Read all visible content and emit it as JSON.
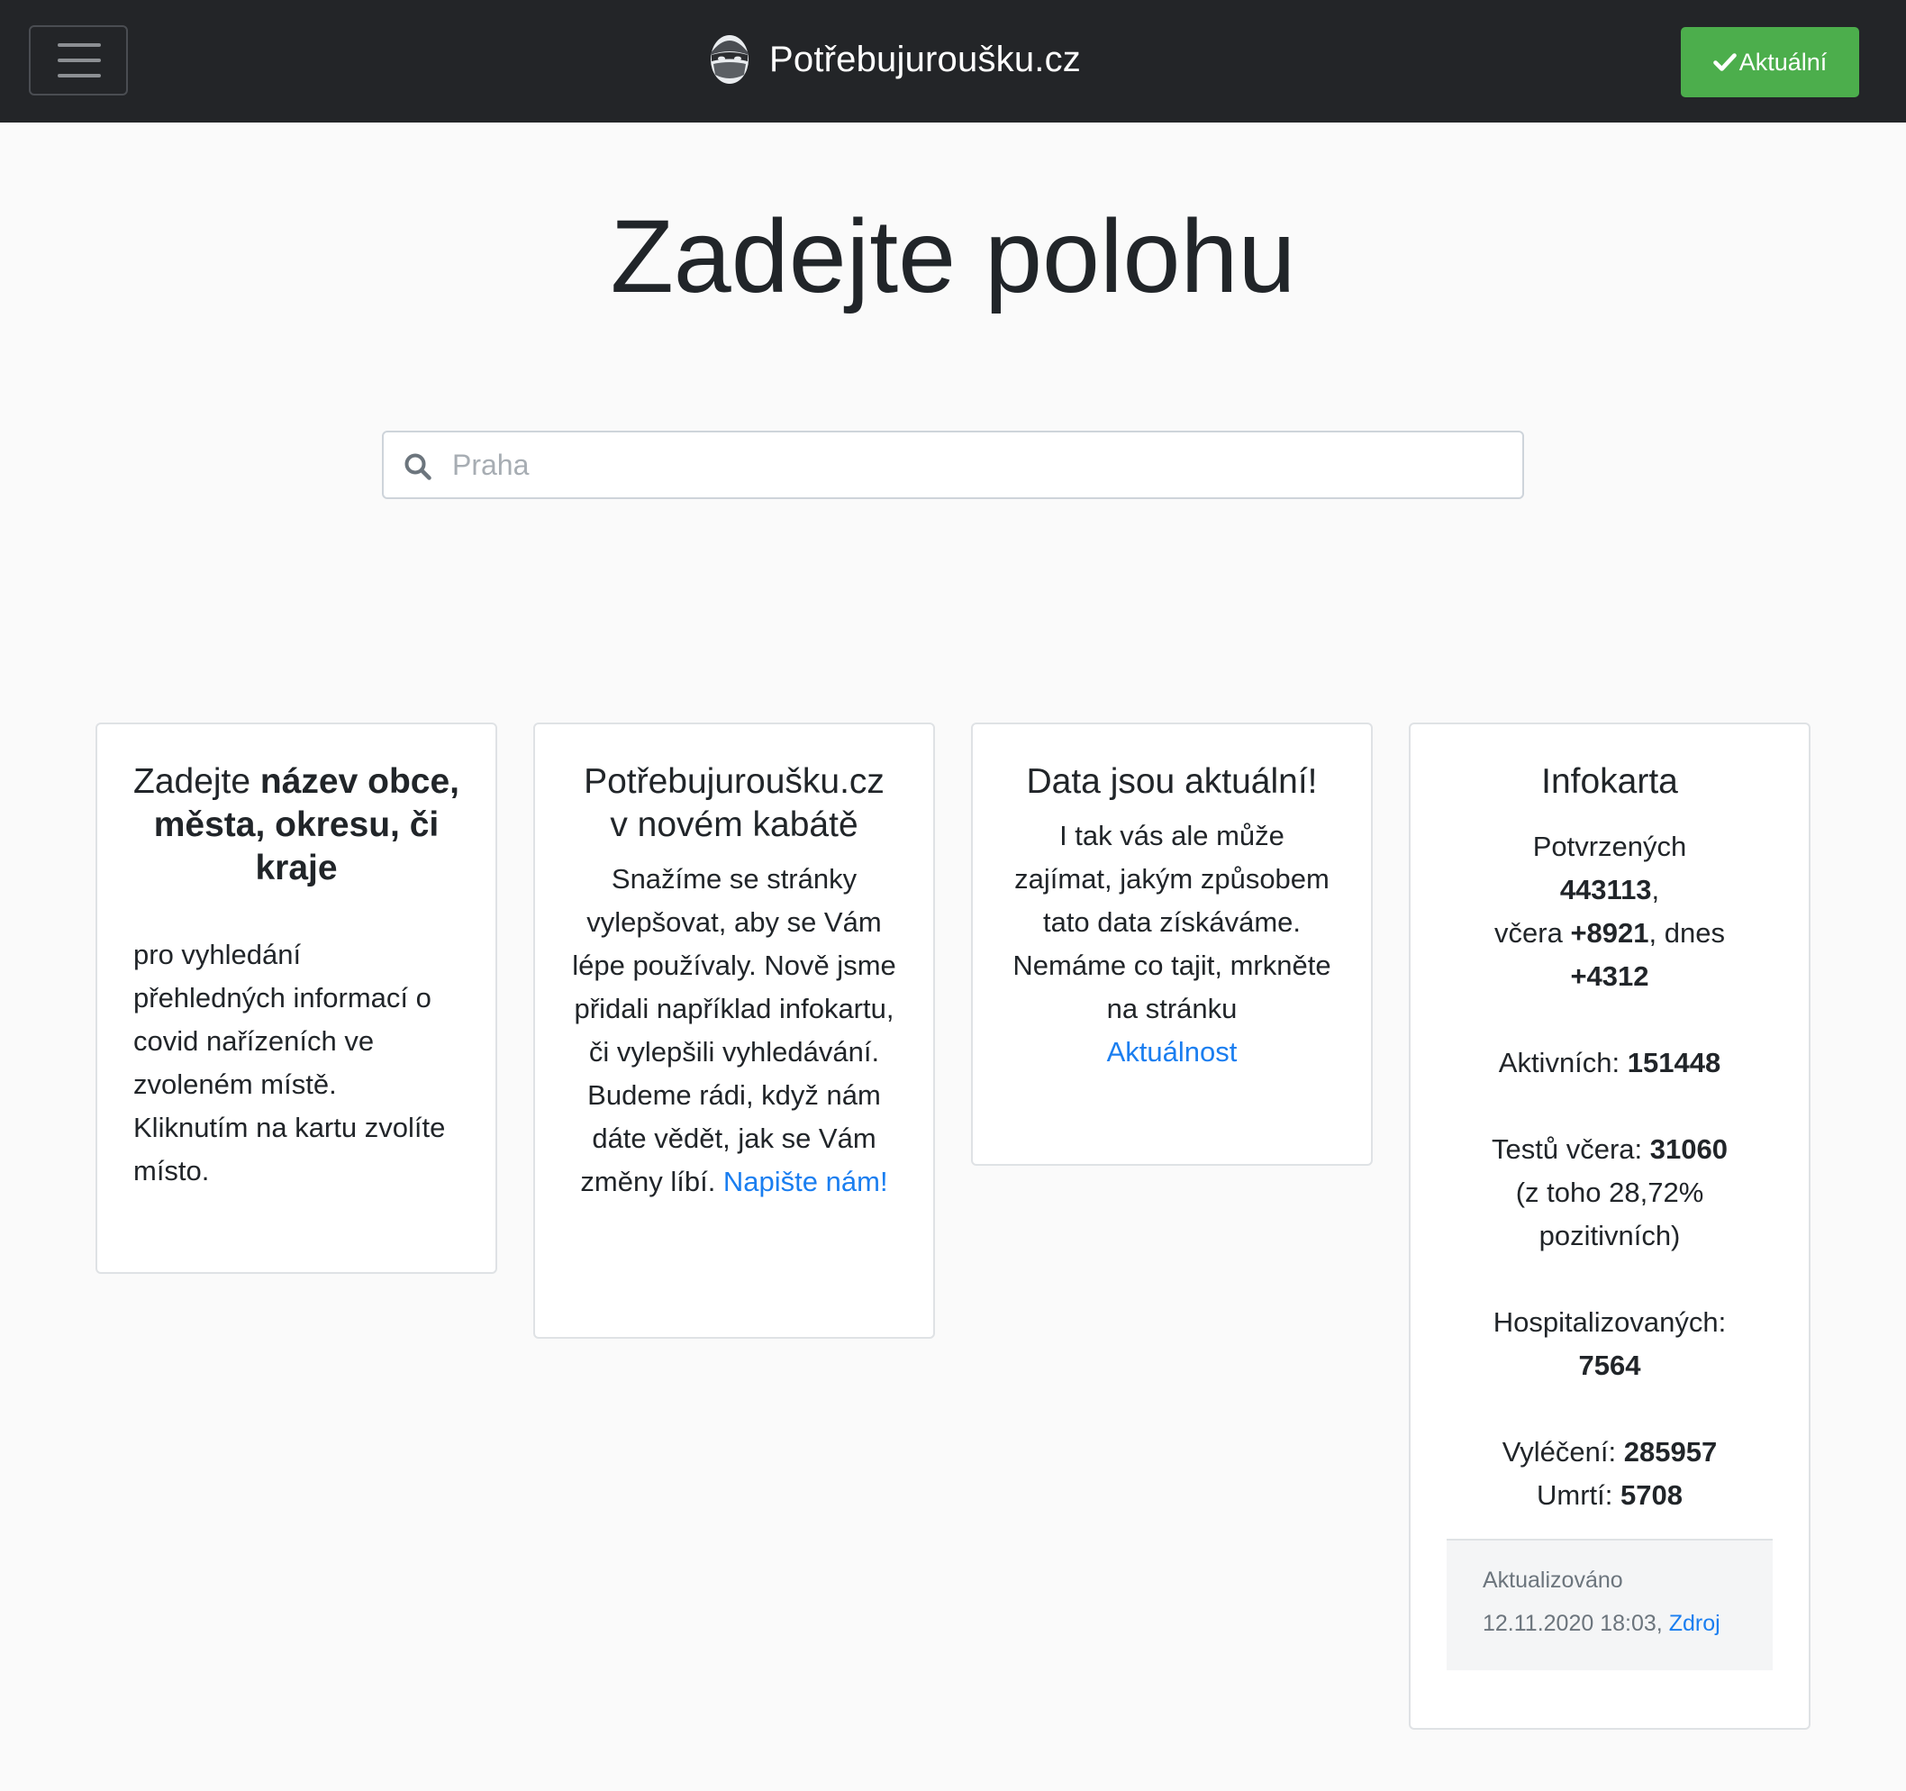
{
  "navbar": {
    "brand_name": "Potřebujuroušku.cz",
    "status_button_label": "Aktuální",
    "colors": {
      "background": "#232528",
      "status_button": "#4cae4c"
    }
  },
  "page": {
    "title": "Zadejte polohu"
  },
  "search": {
    "placeholder": "Praha",
    "value": ""
  },
  "cards": {
    "instructions": {
      "title_prefix": "Zadejte ",
      "title_bold": "název obce, města, okresu, či kraje",
      "text": "pro vyhledání přehledných informací o covid nařízeních ve zvoleném místě. Kliknutím na kartu zvolíte místo."
    },
    "news": {
      "title": "Potřebujuroušku.cz v novém kabátě",
      "text": "Snažíme se stránky vylepšovat, aby se Vám lépe používaly. Nově jsme přidali například infokartu, či vylepšili vyhledávání. Budeme rádi, když nám dáte vědět, jak se Vám změny líbí. ",
      "link_label": "Napište nám!"
    },
    "data": {
      "title": "Data jsou aktuální!",
      "text": "I tak vás ale může zajímat, jakým způsobem tato data získáváme. Nemáme co tajit, mrkněte na stránku",
      "link_label": "Aktuálnost"
    },
    "infocard": {
      "title": "Infokarta",
      "confirmed_label": "Potvrzených",
      "confirmed_value": "443113",
      "yesterday_label": "včera",
      "yesterday_value": "+8921",
      "today_label": "dnes",
      "today_value": "+4312",
      "active_label": "Aktivních:",
      "active_value": "151448",
      "tests_label": "Testů včera:",
      "tests_value": "31060",
      "tests_note": "(z toho 28,72% pozitivních)",
      "hospitalized_label": "Hospitalizovaných:",
      "hospitalized_value": "7564",
      "recovered_label": "Vyléčení:",
      "recovered_value": "285957",
      "deaths_label": "Umrtí:",
      "deaths_value": "5708",
      "footer_updated_label": "Aktualizováno",
      "footer_updated_value": "12.11.2020 18:03,",
      "footer_source_label": "Zdroj"
    }
  },
  "icons": {
    "menu": "hamburger-icon",
    "brand": "masked-face-logo",
    "status": "check-icon",
    "search": "search-icon"
  },
  "colors": {
    "link": "#1a7ef0",
    "page_background": "#fafafa"
  }
}
